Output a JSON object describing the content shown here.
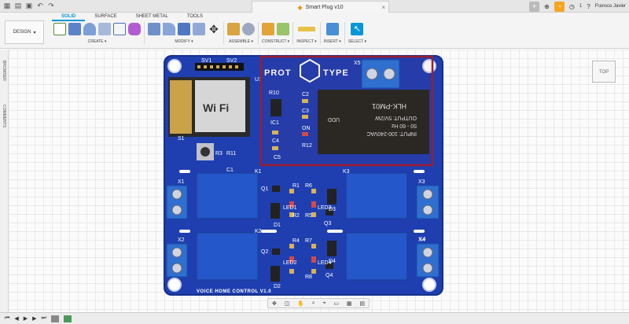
{
  "window": {
    "document_title": "Smart Plug v10",
    "user_name": "Fransco Javier",
    "notif_count": "1"
  },
  "ribbon": {
    "workspace": "DESIGN",
    "tabs": [
      "SOLID",
      "SURFACE",
      "SHEET METAL",
      "TOOLS"
    ],
    "groups": [
      "CREATE ▾",
      "MODIFY ▾",
      "ASSEMBLE ▾",
      "CONSTRUCT ▾",
      "INSPECT ▾",
      "INSERT ▾",
      "SELECT ▾"
    ]
  },
  "panels": {
    "browser": "BROWSER",
    "comments": "COMMENTS"
  },
  "viewcube": {
    "face": "TOP"
  },
  "pcb": {
    "logo_text_left": "PROT",
    "logo_text_right": "TYPE",
    "footer": "VOICE HOME CONTROL V1.0",
    "wifi": "Wi Fi",
    "module_text": [
      "INPUT: 100-240VAC",
      "50 - 60 Hz",
      "OUTPUT: 5V/2W",
      "HLK-PM01",
      "UDD"
    ],
    "labels": {
      "sv1": "SV1",
      "sv2": "SV2",
      "u1": "U1",
      "x5": "X5",
      "r10": "R10",
      "ic1": "IC1",
      "c2": "C2",
      "c3": "C3",
      "c4": "C4",
      "c5": "C5",
      "on": "ON",
      "r12": "R12",
      "s1": "S1",
      "r3": "R3",
      "r11": "R11",
      "c1": "C1",
      "x1": "X1",
      "k1": "K1",
      "x2": "X2",
      "k2": "K2",
      "x3": "X3",
      "k3": "K3",
      "x4": "X4",
      "k4": "K4",
      "r1": "R1",
      "r6": "R6",
      "r2": "R2",
      "r5": "R5",
      "q1": "Q1",
      "q2": "Q2",
      "q3": "Q3",
      "q4": "Q4",
      "d1": "D1",
      "d2": "D2",
      "d3": "D3",
      "d4": "D4",
      "led1": "LED1",
      "led2": "LED2",
      "led3": "LED3",
      "led4": "LED4",
      "r4": "R4",
      "r7": "R7",
      "r8": "R8"
    }
  },
  "colors": {
    "board": "#1f3fb0",
    "board_dark": "#17308c",
    "relay": "#2457c9",
    "highlight": "#9b1d2e",
    "accent": "#0696d7"
  }
}
